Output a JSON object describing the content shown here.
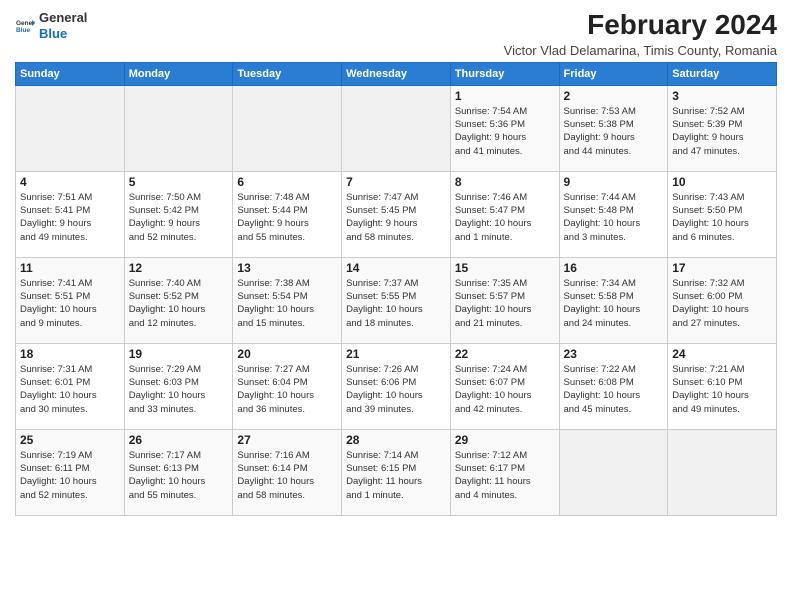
{
  "logo": {
    "general": "General",
    "blue": "Blue"
  },
  "header": {
    "title": "February 2024",
    "subtitle": "Victor Vlad Delamarina, Timis County, Romania"
  },
  "weekdays": [
    "Sunday",
    "Monday",
    "Tuesday",
    "Wednesday",
    "Thursday",
    "Friday",
    "Saturday"
  ],
  "weeks": [
    [
      {
        "day": "",
        "info": ""
      },
      {
        "day": "",
        "info": ""
      },
      {
        "day": "",
        "info": ""
      },
      {
        "day": "",
        "info": ""
      },
      {
        "day": "1",
        "info": "Sunrise: 7:54 AM\nSunset: 5:36 PM\nDaylight: 9 hours\nand 41 minutes."
      },
      {
        "day": "2",
        "info": "Sunrise: 7:53 AM\nSunset: 5:38 PM\nDaylight: 9 hours\nand 44 minutes."
      },
      {
        "day": "3",
        "info": "Sunrise: 7:52 AM\nSunset: 5:39 PM\nDaylight: 9 hours\nand 47 minutes."
      }
    ],
    [
      {
        "day": "4",
        "info": "Sunrise: 7:51 AM\nSunset: 5:41 PM\nDaylight: 9 hours\nand 49 minutes."
      },
      {
        "day": "5",
        "info": "Sunrise: 7:50 AM\nSunset: 5:42 PM\nDaylight: 9 hours\nand 52 minutes."
      },
      {
        "day": "6",
        "info": "Sunrise: 7:48 AM\nSunset: 5:44 PM\nDaylight: 9 hours\nand 55 minutes."
      },
      {
        "day": "7",
        "info": "Sunrise: 7:47 AM\nSunset: 5:45 PM\nDaylight: 9 hours\nand 58 minutes."
      },
      {
        "day": "8",
        "info": "Sunrise: 7:46 AM\nSunset: 5:47 PM\nDaylight: 10 hours\nand 1 minute."
      },
      {
        "day": "9",
        "info": "Sunrise: 7:44 AM\nSunset: 5:48 PM\nDaylight: 10 hours\nand 3 minutes."
      },
      {
        "day": "10",
        "info": "Sunrise: 7:43 AM\nSunset: 5:50 PM\nDaylight: 10 hours\nand 6 minutes."
      }
    ],
    [
      {
        "day": "11",
        "info": "Sunrise: 7:41 AM\nSunset: 5:51 PM\nDaylight: 10 hours\nand 9 minutes."
      },
      {
        "day": "12",
        "info": "Sunrise: 7:40 AM\nSunset: 5:52 PM\nDaylight: 10 hours\nand 12 minutes."
      },
      {
        "day": "13",
        "info": "Sunrise: 7:38 AM\nSunset: 5:54 PM\nDaylight: 10 hours\nand 15 minutes."
      },
      {
        "day": "14",
        "info": "Sunrise: 7:37 AM\nSunset: 5:55 PM\nDaylight: 10 hours\nand 18 minutes."
      },
      {
        "day": "15",
        "info": "Sunrise: 7:35 AM\nSunset: 5:57 PM\nDaylight: 10 hours\nand 21 minutes."
      },
      {
        "day": "16",
        "info": "Sunrise: 7:34 AM\nSunset: 5:58 PM\nDaylight: 10 hours\nand 24 minutes."
      },
      {
        "day": "17",
        "info": "Sunrise: 7:32 AM\nSunset: 6:00 PM\nDaylight: 10 hours\nand 27 minutes."
      }
    ],
    [
      {
        "day": "18",
        "info": "Sunrise: 7:31 AM\nSunset: 6:01 PM\nDaylight: 10 hours\nand 30 minutes."
      },
      {
        "day": "19",
        "info": "Sunrise: 7:29 AM\nSunset: 6:03 PM\nDaylight: 10 hours\nand 33 minutes."
      },
      {
        "day": "20",
        "info": "Sunrise: 7:27 AM\nSunset: 6:04 PM\nDaylight: 10 hours\nand 36 minutes."
      },
      {
        "day": "21",
        "info": "Sunrise: 7:26 AM\nSunset: 6:06 PM\nDaylight: 10 hours\nand 39 minutes."
      },
      {
        "day": "22",
        "info": "Sunrise: 7:24 AM\nSunset: 6:07 PM\nDaylight: 10 hours\nand 42 minutes."
      },
      {
        "day": "23",
        "info": "Sunrise: 7:22 AM\nSunset: 6:08 PM\nDaylight: 10 hours\nand 45 minutes."
      },
      {
        "day": "24",
        "info": "Sunrise: 7:21 AM\nSunset: 6:10 PM\nDaylight: 10 hours\nand 49 minutes."
      }
    ],
    [
      {
        "day": "25",
        "info": "Sunrise: 7:19 AM\nSunset: 6:11 PM\nDaylight: 10 hours\nand 52 minutes."
      },
      {
        "day": "26",
        "info": "Sunrise: 7:17 AM\nSunset: 6:13 PM\nDaylight: 10 hours\nand 55 minutes."
      },
      {
        "day": "27",
        "info": "Sunrise: 7:16 AM\nSunset: 6:14 PM\nDaylight: 10 hours\nand 58 minutes."
      },
      {
        "day": "28",
        "info": "Sunrise: 7:14 AM\nSunset: 6:15 PM\nDaylight: 11 hours\nand 1 minute."
      },
      {
        "day": "29",
        "info": "Sunrise: 7:12 AM\nSunset: 6:17 PM\nDaylight: 11 hours\nand 4 minutes."
      },
      {
        "day": "",
        "info": ""
      },
      {
        "day": "",
        "info": ""
      }
    ]
  ]
}
